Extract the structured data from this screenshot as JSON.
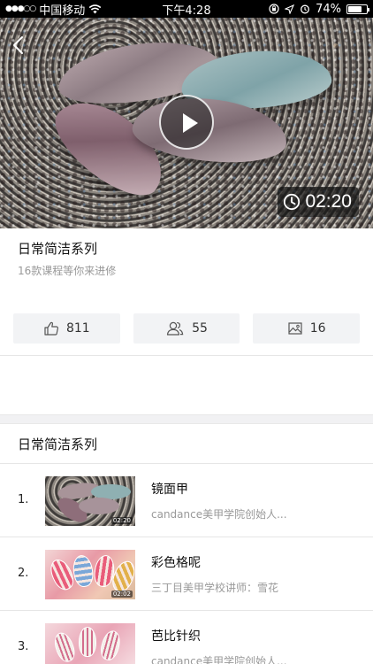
{
  "status_bar": {
    "signal_dots": "●●●○○",
    "carrier": "中国移动",
    "time": "下午4:28",
    "battery": "74%",
    "battery_level": 0.74
  },
  "video": {
    "duration": "02:20"
  },
  "course": {
    "title": "日常简洁系列",
    "subtitle": "16款课程等你来进修"
  },
  "stats": {
    "likes": "811",
    "students": "55",
    "images": "16"
  },
  "section": {
    "title": "日常简洁系列"
  },
  "lessons": [
    {
      "index": "1.",
      "title": "镜面甲",
      "author": "candance美甲学院创始人...",
      "thumb_duration": "02:20"
    },
    {
      "index": "2.",
      "title": "彩色格呢",
      "author": "三丁目美甲学校讲师：雪花",
      "thumb_duration": "02:02"
    },
    {
      "index": "3.",
      "title": "芭比针织",
      "author": "candance美甲学院创始人..."
    }
  ],
  "icons": {
    "back": "chevron-left-icon",
    "play": "play-icon",
    "clock": "clock-icon",
    "like": "thumbs-up-icon",
    "students": "users-icon",
    "images": "image-icon"
  }
}
